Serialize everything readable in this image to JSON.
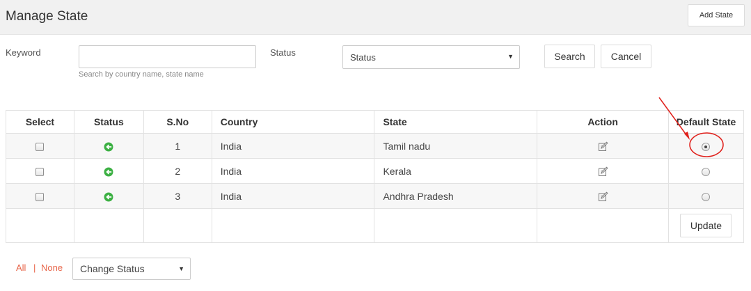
{
  "header": {
    "title": "Manage State",
    "add_state_label": "Add State"
  },
  "filters": {
    "keyword_label": "Keyword",
    "keyword_value": "",
    "keyword_hint": "Search by country name, state name",
    "status_label": "Status",
    "status_selected": "Status",
    "search_label": "Search",
    "cancel_label": "Cancel"
  },
  "table": {
    "headers": {
      "select": "Select",
      "status": "Status",
      "sno": "S.No",
      "country": "Country",
      "state": "State",
      "action": "Action",
      "default_state": "Default State"
    },
    "rows": [
      {
        "sno": "1",
        "country": "India",
        "state": "Tamil nadu",
        "checked": false,
        "active": true,
        "default": true
      },
      {
        "sno": "2",
        "country": "India",
        "state": "Kerala",
        "checked": false,
        "active": true,
        "default": false
      },
      {
        "sno": "3",
        "country": "India",
        "state": "Andhra Pradesh",
        "checked": false,
        "active": true,
        "default": false
      }
    ],
    "update_label": "Update"
  },
  "footer": {
    "all_label": "All",
    "separator": "|",
    "none_label": "None",
    "change_status_selected": "Change Status"
  },
  "colors": {
    "accent_link": "#e8664a",
    "status_active": "#3cb043",
    "annotation": "#e0201b"
  }
}
